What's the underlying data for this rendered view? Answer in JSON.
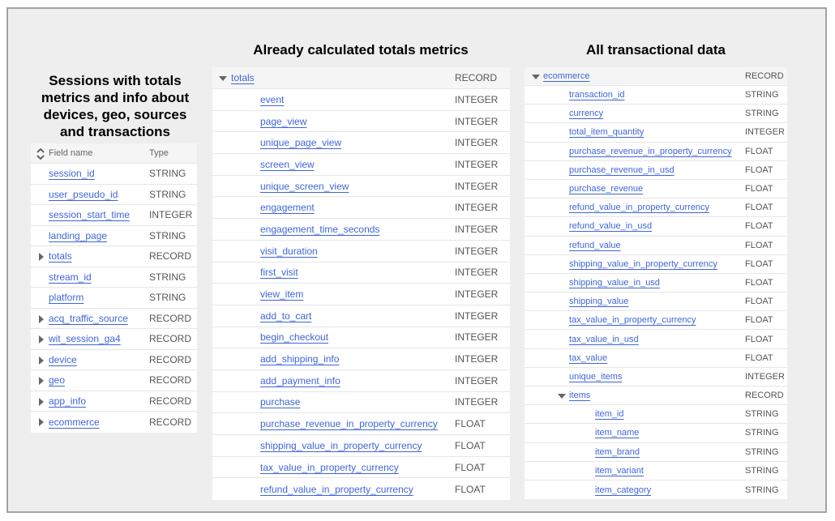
{
  "captions": {
    "left": "Sessions with totals metrics and info about devices, geo, sources and transactions",
    "middle": "Already calculated totals metrics",
    "right": "All transactional data"
  },
  "left_table": {
    "header": {
      "sort_icon": "sort-unfold-icon",
      "field_label": "Field name",
      "type_label": "Type"
    },
    "rows": [
      {
        "name": "session_id",
        "type": "STRING",
        "expandable": false
      },
      {
        "name": "user_pseudo_id",
        "type": "STRING",
        "expandable": false
      },
      {
        "name": "session_start_time",
        "type": "INTEGER",
        "expandable": false
      },
      {
        "name": "landing_page",
        "type": "STRING",
        "expandable": false
      },
      {
        "name": "totals",
        "type": "RECORD",
        "expandable": true,
        "expanded": false
      },
      {
        "name": "stream_id",
        "type": "STRING",
        "expandable": false
      },
      {
        "name": "platform",
        "type": "STRING",
        "expandable": false
      },
      {
        "name": "acq_traffic_source",
        "type": "RECORD",
        "expandable": true,
        "expanded": false
      },
      {
        "name": "wit_session_ga4",
        "type": "RECORD",
        "expandable": true,
        "expanded": false
      },
      {
        "name": "device",
        "type": "RECORD",
        "expandable": true,
        "expanded": false
      },
      {
        "name": "geo",
        "type": "RECORD",
        "expandable": true,
        "expanded": false
      },
      {
        "name": "app_info",
        "type": "RECORD",
        "expandable": true,
        "expanded": false
      },
      {
        "name": "ecommerce",
        "type": "RECORD",
        "expandable": true,
        "expanded": false
      }
    ]
  },
  "middle_table": {
    "parent": {
      "name": "totals",
      "type": "RECORD",
      "expanded": true
    },
    "rows": [
      {
        "name": "event",
        "type": "INTEGER"
      },
      {
        "name": "page_view",
        "type": "INTEGER"
      },
      {
        "name": "unique_page_view",
        "type": "INTEGER"
      },
      {
        "name": "screen_view",
        "type": "INTEGER"
      },
      {
        "name": "unique_screen_view",
        "type": "INTEGER"
      },
      {
        "name": "engagement",
        "type": "INTEGER"
      },
      {
        "name": "engagement_time_seconds",
        "type": "INTEGER"
      },
      {
        "name": "visit_duration",
        "type": "INTEGER"
      },
      {
        "name": "first_visit",
        "type": "INTEGER"
      },
      {
        "name": "view_item",
        "type": "INTEGER"
      },
      {
        "name": "add_to_cart",
        "type": "INTEGER"
      },
      {
        "name": "begin_checkout",
        "type": "INTEGER"
      },
      {
        "name": "add_shipping_info",
        "type": "INTEGER"
      },
      {
        "name": "add_payment_info",
        "type": "INTEGER"
      },
      {
        "name": "purchase",
        "type": "INTEGER"
      },
      {
        "name": "purchase_revenue_in_property_currency",
        "type": "FLOAT"
      },
      {
        "name": "shipping_value_in_property_currency",
        "type": "FLOAT"
      },
      {
        "name": "tax_value_in_property_currency",
        "type": "FLOAT"
      },
      {
        "name": "refund_value_in_property_currency",
        "type": "FLOAT"
      }
    ]
  },
  "right_table": {
    "parent": {
      "name": "ecommerce",
      "type": "RECORD",
      "expanded": true
    },
    "rows": [
      {
        "name": "transaction_id",
        "type": "STRING",
        "level": 1
      },
      {
        "name": "currency",
        "type": "STRING",
        "level": 1
      },
      {
        "name": "total_item_quantity",
        "type": "INTEGER",
        "level": 1
      },
      {
        "name": "purchase_revenue_in_property_currency",
        "type": "FLOAT",
        "level": 1
      },
      {
        "name": "purchase_revenue_in_usd",
        "type": "FLOAT",
        "level": 1
      },
      {
        "name": "purchase_revenue",
        "type": "FLOAT",
        "level": 1
      },
      {
        "name": "refund_value_in_property_currency",
        "type": "FLOAT",
        "level": 1
      },
      {
        "name": "refund_value_in_usd",
        "type": "FLOAT",
        "level": 1
      },
      {
        "name": "refund_value",
        "type": "FLOAT",
        "level": 1
      },
      {
        "name": "shipping_value_in_property_currency",
        "type": "FLOAT",
        "level": 1
      },
      {
        "name": "shipping_value_in_usd",
        "type": "FLOAT",
        "level": 1
      },
      {
        "name": "shipping_value",
        "type": "FLOAT",
        "level": 1
      },
      {
        "name": "tax_value_in_property_currency",
        "type": "FLOAT",
        "level": 1
      },
      {
        "name": "tax_value_in_usd",
        "type": "FLOAT",
        "level": 1
      },
      {
        "name": "tax_value",
        "type": "FLOAT",
        "level": 1
      },
      {
        "name": "unique_items",
        "type": "INTEGER",
        "level": 1
      },
      {
        "name": "items",
        "type": "RECORD",
        "level": 1,
        "expandable": true,
        "expanded": true
      },
      {
        "name": "item_id",
        "type": "STRING",
        "level": 2
      },
      {
        "name": "item_name",
        "type": "STRING",
        "level": 2
      },
      {
        "name": "item_brand",
        "type": "STRING",
        "level": 2
      },
      {
        "name": "item_variant",
        "type": "STRING",
        "level": 2
      },
      {
        "name": "item_category",
        "type": "STRING",
        "level": 2
      }
    ]
  },
  "colors": {
    "background": "#eeeeee",
    "frame_border": "#a3a3a3",
    "link": "#3f66d8",
    "type_text": "#555555",
    "header_bg": "#f5f5f5"
  }
}
